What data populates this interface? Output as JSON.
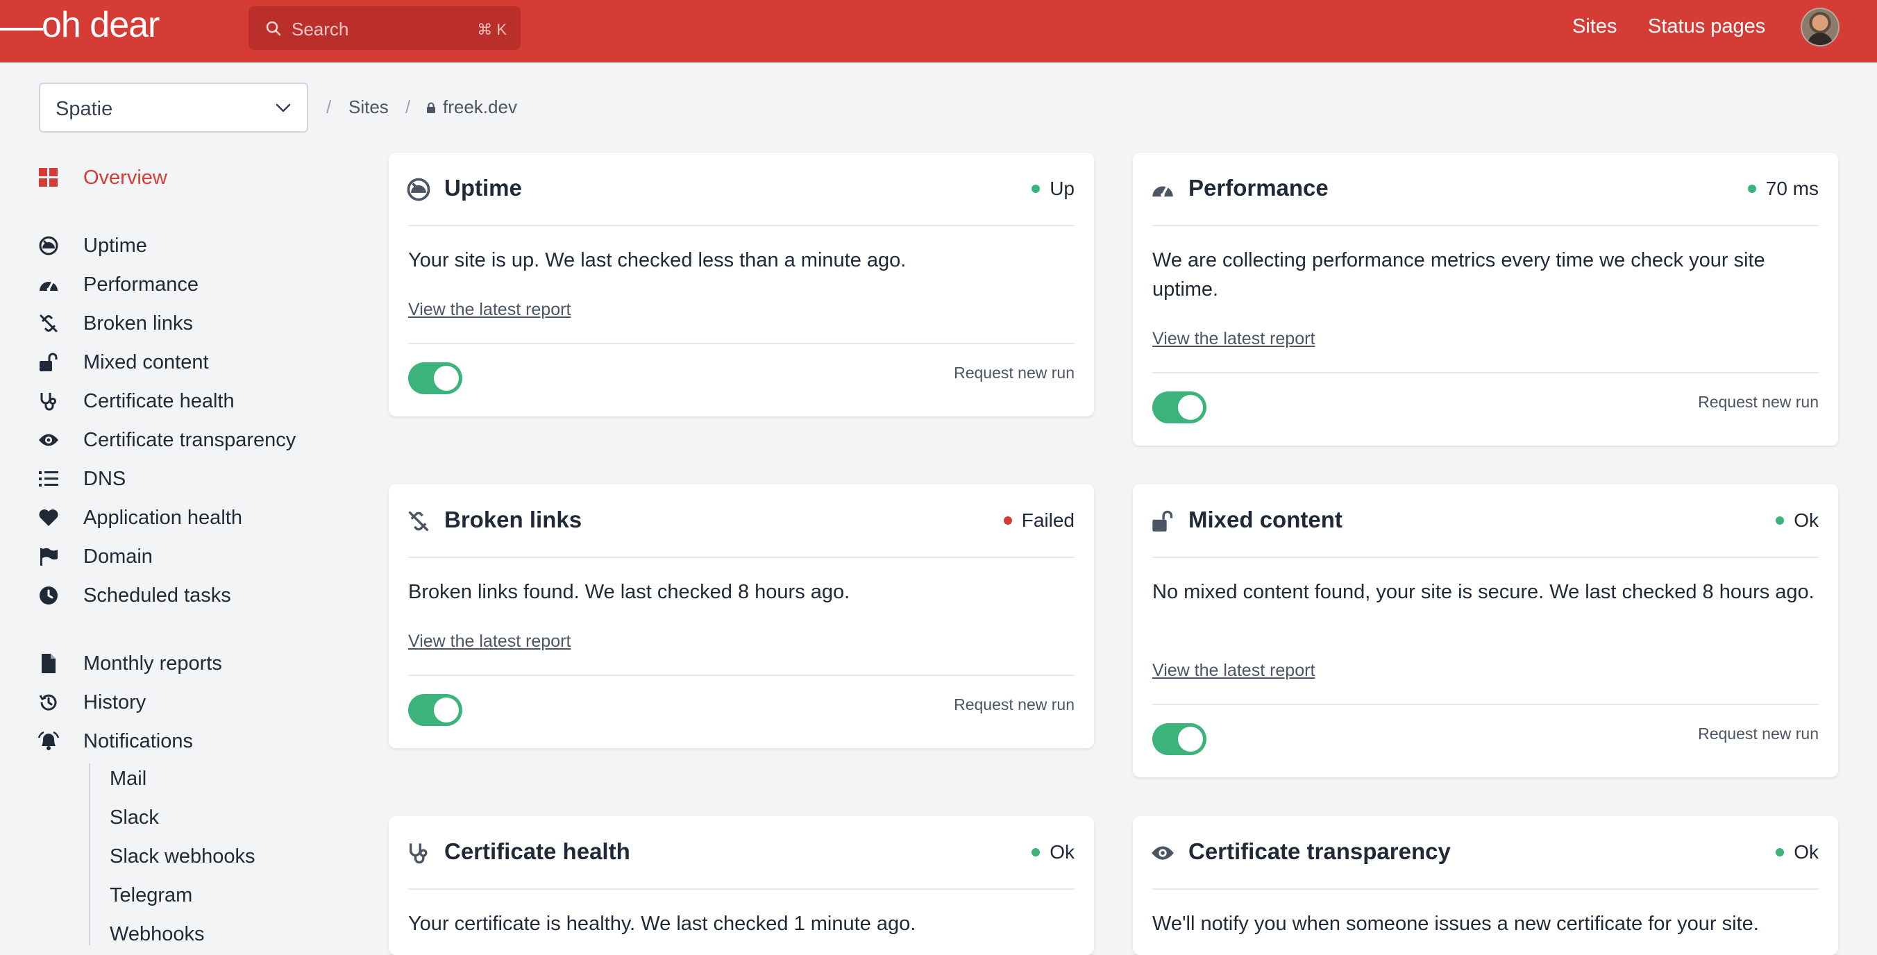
{
  "header": {
    "logo_text": "oh dear",
    "search_placeholder": "Search",
    "search_shortcut": "⌘ K",
    "nav": [
      "Sites",
      "Status pages"
    ]
  },
  "breadcrumb": {
    "team": "Spatie",
    "items": [
      "Sites",
      "freek.dev"
    ]
  },
  "sidebar": {
    "overview": "Overview",
    "checks": [
      {
        "label": "Uptime",
        "icon": "gauge-icon"
      },
      {
        "label": "Performance",
        "icon": "speedometer-icon"
      },
      {
        "label": "Broken links",
        "icon": "broken-link-icon"
      },
      {
        "label": "Mixed content",
        "icon": "unlock-icon"
      },
      {
        "label": "Certificate health",
        "icon": "stethoscope-icon"
      },
      {
        "label": "Certificate transparency",
        "icon": "eye-icon"
      },
      {
        "label": "DNS",
        "icon": "list-icon"
      },
      {
        "label": "Application health",
        "icon": "heart-icon"
      },
      {
        "label": "Domain",
        "icon": "flag-icon"
      },
      {
        "label": "Scheduled tasks",
        "icon": "clock-icon"
      }
    ],
    "extra": [
      {
        "label": "Monthly reports",
        "icon": "file-icon"
      },
      {
        "label": "History",
        "icon": "history-icon"
      },
      {
        "label": "Notifications",
        "icon": "bell-icon"
      }
    ],
    "notification_channels": [
      "Mail",
      "Slack",
      "Slack webhooks",
      "Telegram",
      "Webhooks"
    ]
  },
  "cards": {
    "uptime": {
      "title": "Uptime",
      "status": "Up",
      "status_color": "#3cb37a",
      "description": "Your site is up. We last checked less than a minute ago.",
      "link": "View the latest report",
      "run": "Request new run"
    },
    "performance": {
      "title": "Performance",
      "status": "70 ms",
      "status_color": "#3cb37a",
      "description": "We are collecting performance metrics every time we check your site uptime.",
      "link": "View the latest report",
      "run": "Request new run"
    },
    "broken_links": {
      "title": "Broken links",
      "status": "Failed",
      "status_color": "#d63c36",
      "description": "Broken links found. We last checked 8 hours ago.",
      "link": "View the latest report",
      "run": "Request new run"
    },
    "mixed_content": {
      "title": "Mixed content",
      "status": "Ok",
      "status_color": "#3cb37a",
      "description": "No mixed content found, your site is secure. We last checked 8 hours ago.",
      "link": "View the latest report",
      "run": "Request new run"
    },
    "certificate_health": {
      "title": "Certificate health",
      "status": "Ok",
      "status_color": "#3cb37a",
      "description": "Your certificate is healthy. We last checked 1 minute ago."
    },
    "certificate_transparency": {
      "title": "Certificate transparency",
      "status": "Ok",
      "status_color": "#3cb37a",
      "description": "We'll notify you when someone issues a new certificate for your site."
    }
  },
  "colors": {
    "brand": "#d63c36",
    "ok": "#3cb37a"
  }
}
